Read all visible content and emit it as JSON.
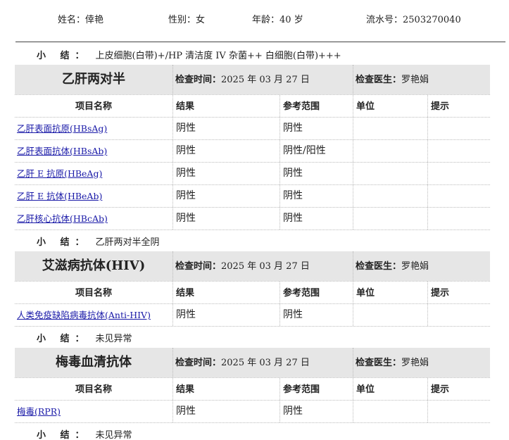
{
  "patient": {
    "name_label": "姓名：",
    "name": "倖艳",
    "gender_label": "性别：",
    "gender": "女",
    "age_label": "年龄：",
    "age": "40 岁",
    "serial_label": "流水号：",
    "serial": "2503270040"
  },
  "summary_label": "小  结：",
  "top_summary": "上皮细胞(白带)+/HP   清洁度 IV   杂菌++   白细胞(白带)+++",
  "columns": {
    "item": "项目名称",
    "result": "结果",
    "range": "参考范围",
    "unit": "单位",
    "hint": "提示"
  },
  "sections": [
    {
      "title": "乙肝两对半",
      "time_label": "检查时间：",
      "time": "2025 年 03 月 27 日",
      "doctor_label": "检查医生：",
      "doctor": "罗艳娟",
      "rows": [
        {
          "item": "乙肝表面抗原(HBsAg)",
          "result": "阴性",
          "range": "阴性",
          "unit": "",
          "hint": ""
        },
        {
          "item": "乙肝表面抗体(HBsAb)",
          "result": "阴性",
          "range": "阴性/阳性",
          "unit": "",
          "hint": ""
        },
        {
          "item": "乙肝 E 抗原(HBeAg)",
          "result": "阴性",
          "range": "阴性",
          "unit": "",
          "hint": ""
        },
        {
          "item": "乙肝 E 抗体(HBeAb)",
          "result": "阴性",
          "range": "阴性",
          "unit": "",
          "hint": ""
        },
        {
          "item": "乙肝核心抗体(HBcAb)",
          "result": "阴性",
          "range": "阴性",
          "unit": "",
          "hint": ""
        }
      ],
      "summary": "乙肝两对半全阴"
    },
    {
      "title": "艾滋病抗体(HIV)",
      "time_label": "检查时间：",
      "time": "2025 年 03 月 27 日",
      "doctor_label": "检查医生：",
      "doctor": "罗艳娟",
      "rows": [
        {
          "item": "人类免疫缺陷病毒抗体(Anti-HIV)",
          "result": "阴性",
          "range": "阴性",
          "unit": "",
          "hint": ""
        }
      ],
      "summary": "未见异常"
    },
    {
      "title": "梅毒血清抗体",
      "time_label": "检查时间：",
      "time": "2025 年 03 月 27 日",
      "doctor_label": "检查医生：",
      "doctor": "罗艳娟",
      "rows": [
        {
          "item": "梅毒(RPR)",
          "result": "阴性",
          "range": "阴性",
          "unit": "",
          "hint": ""
        }
      ],
      "summary": "未见异常"
    }
  ]
}
